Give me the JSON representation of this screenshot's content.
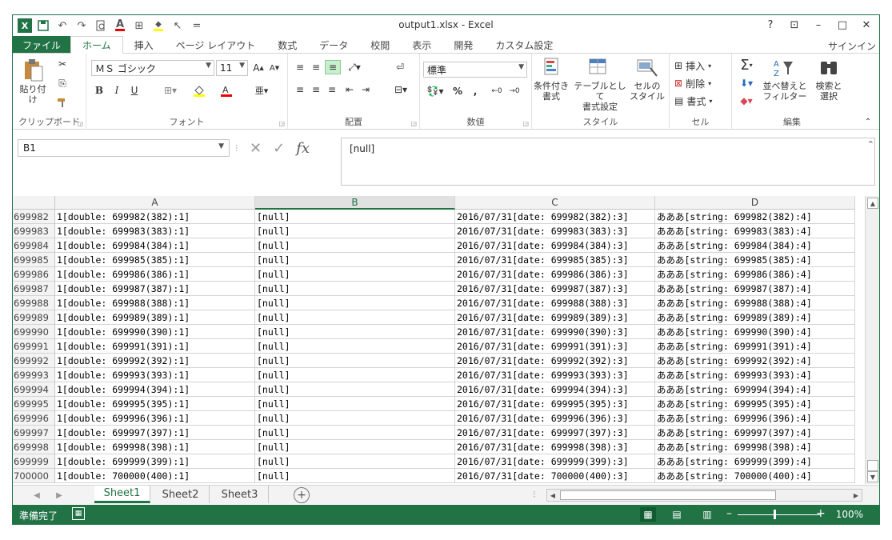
{
  "window": {
    "title": "output1.xlsx - Excel",
    "help": "?",
    "ribbon_display": "⊡",
    "minimize": "–",
    "maximize": "□",
    "close": "✕"
  },
  "qat": {
    "logo": "X",
    "save": "💾",
    "undo": "↶",
    "redo": "↷",
    "preview": "🔍",
    "font_color": "A",
    "border": "⊞",
    "fill": "◆",
    "select": "↖",
    "more": "="
  },
  "tabs": [
    "ファイル",
    "ホーム",
    "挿入",
    "ページ レイアウト",
    "数式",
    "データ",
    "校閲",
    "表示",
    "開発",
    "カスタム設定"
  ],
  "signin": "サインイン",
  "ribbon": {
    "clipboard": {
      "label": "クリップボード",
      "paste": "貼り付け"
    },
    "font": {
      "label": "フォント",
      "name": "ＭＳ ゴシック",
      "size": "11",
      "bold": "B",
      "italic": "I",
      "underline": "U"
    },
    "alignment": {
      "label": "配置"
    },
    "number": {
      "label": "数値",
      "format": "標準",
      "percent": "%",
      "comma": ","
    },
    "styles": {
      "label": "スタイル",
      "cond": "条件付き\n書式",
      "table": "テーブルとして\n書式設定",
      "cell": "セルの\nスタイル"
    },
    "cells": {
      "label": "セル",
      "insert": "挿入",
      "delete": "削除",
      "format": "書式"
    },
    "editing": {
      "label": "編集",
      "sort": "並べ替えと\nフィルター",
      "find": "検索と\n選択"
    }
  },
  "formula_bar": {
    "name_box": "B1",
    "fx": "fx",
    "content": "[null]"
  },
  "columns": [
    "A",
    "B",
    "C",
    "D"
  ],
  "selected_column": "B",
  "rows": [
    {
      "n": "699982",
      "a": "1[double: 699982(382):1]",
      "b": "[null]",
      "c": "2016/07/31[date: 699982(382):3]",
      "d": "あああ[string: 699982(382):4]"
    },
    {
      "n": "699983",
      "a": "1[double: 699983(383):1]",
      "b": "[null]",
      "c": "2016/07/31[date: 699983(383):3]",
      "d": "あああ[string: 699983(383):4]"
    },
    {
      "n": "699984",
      "a": "1[double: 699984(384):1]",
      "b": "[null]",
      "c": "2016/07/31[date: 699984(384):3]",
      "d": "あああ[string: 699984(384):4]"
    },
    {
      "n": "699985",
      "a": "1[double: 699985(385):1]",
      "b": "[null]",
      "c": "2016/07/31[date: 699985(385):3]",
      "d": "あああ[string: 699985(385):4]"
    },
    {
      "n": "699986",
      "a": "1[double: 699986(386):1]",
      "b": "[null]",
      "c": "2016/07/31[date: 699986(386):3]",
      "d": "あああ[string: 699986(386):4]"
    },
    {
      "n": "699987",
      "a": "1[double: 699987(387):1]",
      "b": "[null]",
      "c": "2016/07/31[date: 699987(387):3]",
      "d": "あああ[string: 699987(387):4]"
    },
    {
      "n": "699988",
      "a": "1[double: 699988(388):1]",
      "b": "[null]",
      "c": "2016/07/31[date: 699988(388):3]",
      "d": "あああ[string: 699988(388):4]"
    },
    {
      "n": "699989",
      "a": "1[double: 699989(389):1]",
      "b": "[null]",
      "c": "2016/07/31[date: 699989(389):3]",
      "d": "あああ[string: 699989(389):4]"
    },
    {
      "n": "699990",
      "a": "1[double: 699990(390):1]",
      "b": "[null]",
      "c": "2016/07/31[date: 699990(390):3]",
      "d": "あああ[string: 699990(390):4]"
    },
    {
      "n": "699991",
      "a": "1[double: 699991(391):1]",
      "b": "[null]",
      "c": "2016/07/31[date: 699991(391):3]",
      "d": "あああ[string: 699991(391):4]"
    },
    {
      "n": "699992",
      "a": "1[double: 699992(392):1]",
      "b": "[null]",
      "c": "2016/07/31[date: 699992(392):3]",
      "d": "あああ[string: 699992(392):4]"
    },
    {
      "n": "699993",
      "a": "1[double: 699993(393):1]",
      "b": "[null]",
      "c": "2016/07/31[date: 699993(393):3]",
      "d": "あああ[string: 699993(393):4]"
    },
    {
      "n": "699994",
      "a": "1[double: 699994(394):1]",
      "b": "[null]",
      "c": "2016/07/31[date: 699994(394):3]",
      "d": "あああ[string: 699994(394):4]"
    },
    {
      "n": "699995",
      "a": "1[double: 699995(395):1]",
      "b": "[null]",
      "c": "2016/07/31[date: 699995(395):3]",
      "d": "あああ[string: 699995(395):4]"
    },
    {
      "n": "699996",
      "a": "1[double: 699996(396):1]",
      "b": "[null]",
      "c": "2016/07/31[date: 699996(396):3]",
      "d": "あああ[string: 699996(396):4]"
    },
    {
      "n": "699997",
      "a": "1[double: 699997(397):1]",
      "b": "[null]",
      "c": "2016/07/31[date: 699997(397):3]",
      "d": "あああ[string: 699997(397):4]"
    },
    {
      "n": "699998",
      "a": "1[double: 699998(398):1]",
      "b": "[null]",
      "c": "2016/07/31[date: 699998(398):3]",
      "d": "あああ[string: 699998(398):4]"
    },
    {
      "n": "699999",
      "a": "1[double: 699999(399):1]",
      "b": "[null]",
      "c": "2016/07/31[date: 699999(399):3]",
      "d": "あああ[string: 699999(399):4]"
    },
    {
      "n": "700000",
      "a": "1[double: 700000(400):1]",
      "b": "[null]",
      "c": "2016/07/31[date: 700000(400):3]",
      "d": "あああ[string: 700000(400):4]"
    }
  ],
  "sheets": [
    "Sheet1",
    "Sheet2",
    "Sheet3"
  ],
  "active_sheet": "Sheet1",
  "status": {
    "text": "準備完了",
    "zoom": "100%"
  },
  "colors": {
    "accent": "#217346"
  }
}
